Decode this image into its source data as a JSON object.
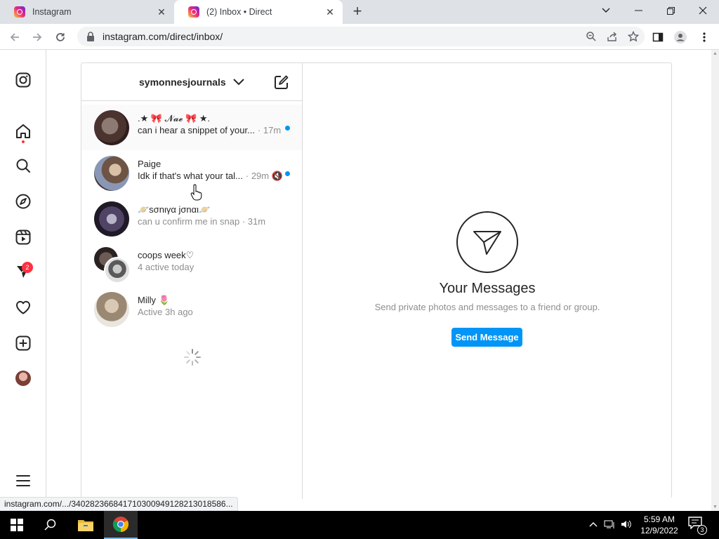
{
  "browser": {
    "tabs": [
      {
        "title": "Instagram",
        "close": "✕"
      },
      {
        "title": "(2) Inbox • Direct",
        "close": "✕"
      }
    ],
    "new_tab": "+",
    "url": "instagram.com/direct/inbox/",
    "status_url": "instagram.com/.../340282366841710300949128213018586..."
  },
  "ig_nav": {
    "direct_badge": "2"
  },
  "dm": {
    "username": "symonnesjournals",
    "threads": [
      {
        "name": ".★ 🎀 𝓝𝓪𝓮 🎀 ★.",
        "message": "can i hear a snippet of your...",
        "time": "· 17m",
        "unread": true
      },
      {
        "name": "Paige",
        "message": "Idk if that's what your tal...",
        "time": "· 29m 🔇",
        "unread": true
      },
      {
        "name": "🪐sσnιγα jσnαι🪐",
        "message": "can u confirm me in snap · 31m",
        "time": "",
        "unread": false
      },
      {
        "name": "coops week♡",
        "message": "4 active today",
        "time": "",
        "unread": false
      },
      {
        "name": "Milly 🌷",
        "message": "Active 3h ago",
        "time": "",
        "unread": false
      }
    ],
    "empty_title": "Your Messages",
    "empty_sub": "Send private photos and messages to a friend or group.",
    "send_button": "Send Message"
  },
  "taskbar": {
    "time": "5:59 AM",
    "date": "12/9/2022",
    "notifications": "3"
  },
  "colors": {
    "accent": "#0095f6",
    "badge": "#ff3040"
  }
}
